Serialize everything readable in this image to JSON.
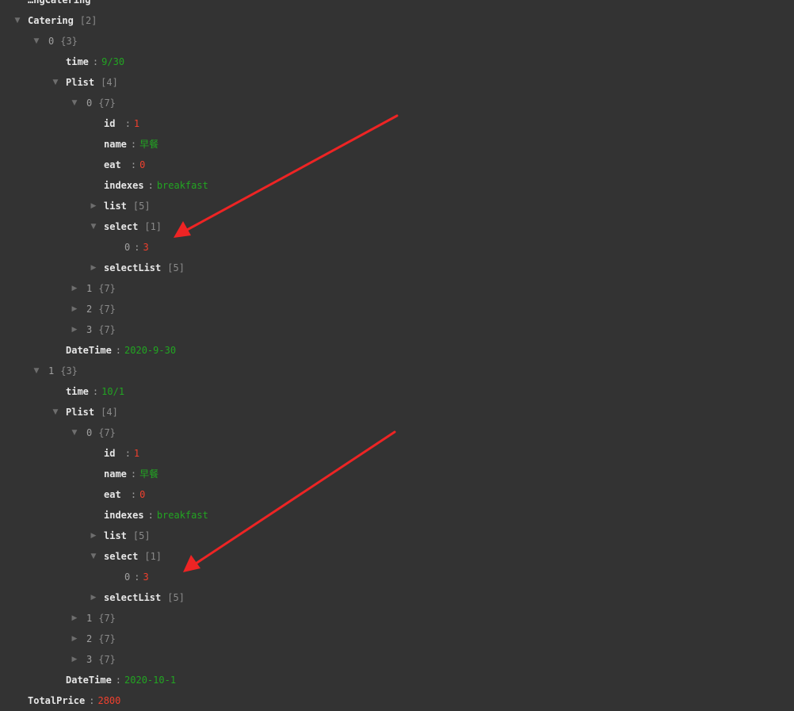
{
  "colors": {
    "background": "#333333",
    "key": "#e6e6e6",
    "number": "#f0402e",
    "string": "#22a522",
    "count": "#8a8a8a",
    "arrow": "#ee2424"
  },
  "icons": {
    "expanded": "caret-down-icon",
    "collapsed": "caret-right-icon"
  },
  "rows": [
    {
      "text_key": "…ngCatering",
      "kind": "key",
      "depth": 0,
      "toggle": "none",
      "partial": true
    },
    {
      "key": "Catering",
      "count": "[2]",
      "kind": "key",
      "depth": 0,
      "toggle": "open"
    },
    {
      "key": "0",
      "count": "{3}",
      "kind": "idx",
      "depth": 1,
      "toggle": "open"
    },
    {
      "key": "time",
      "value": "9/30",
      "vtype": "str",
      "kind": "key",
      "depth": 2,
      "toggle": "none"
    },
    {
      "key": "Plist",
      "count": "[4]",
      "kind": "key",
      "depth": 2,
      "toggle": "open"
    },
    {
      "key": "0",
      "count": "{7}",
      "kind": "idx",
      "depth": 3,
      "toggle": "open"
    },
    {
      "key": "id  ",
      "value": "1",
      "vtype": "num",
      "kind": "key",
      "depth": 4,
      "toggle": "none"
    },
    {
      "key": "name",
      "value": "早餐",
      "vtype": "str",
      "kind": "key",
      "depth": 4,
      "toggle": "none"
    },
    {
      "key": "eat ",
      "value": "0",
      "vtype": "num",
      "kind": "key",
      "depth": 4,
      "toggle": "none"
    },
    {
      "key": "indexes",
      "value": "breakfast",
      "vtype": "str",
      "kind": "key",
      "depth": 4,
      "toggle": "none"
    },
    {
      "key": "list",
      "count": "[5]",
      "kind": "key",
      "depth": 4,
      "toggle": "closed"
    },
    {
      "key": "select",
      "count": "[1]",
      "kind": "key",
      "depth": 4,
      "toggle": "open"
    },
    {
      "key": "0",
      "value": "3",
      "vtype": "num",
      "kind": "idx",
      "depth": 5,
      "toggle": "none"
    },
    {
      "key": "selectList",
      "count": "[5]",
      "kind": "key",
      "depth": 4,
      "toggle": "closed"
    },
    {
      "key": "1",
      "count": "{7}",
      "kind": "idx",
      "depth": 3,
      "toggle": "closed"
    },
    {
      "key": "2",
      "count": "{7}",
      "kind": "idx",
      "depth": 3,
      "toggle": "closed"
    },
    {
      "key": "3",
      "count": "{7}",
      "kind": "idx",
      "depth": 3,
      "toggle": "closed"
    },
    {
      "key": "DateTime",
      "value": "2020-9-30",
      "vtype": "str",
      "kind": "key",
      "depth": 2,
      "toggle": "none"
    },
    {
      "key": "1",
      "count": "{3}",
      "kind": "idx",
      "depth": 1,
      "toggle": "open"
    },
    {
      "key": "time",
      "value": "10/1",
      "vtype": "str",
      "kind": "key",
      "depth": 2,
      "toggle": "none"
    },
    {
      "key": "Plist",
      "count": "[4]",
      "kind": "key",
      "depth": 2,
      "toggle": "open"
    },
    {
      "key": "0",
      "count": "{7}",
      "kind": "idx",
      "depth": 3,
      "toggle": "open"
    },
    {
      "key": "id  ",
      "value": "1",
      "vtype": "num",
      "kind": "key",
      "depth": 4,
      "toggle": "none"
    },
    {
      "key": "name",
      "value": "早餐",
      "vtype": "str",
      "kind": "key",
      "depth": 4,
      "toggle": "none"
    },
    {
      "key": "eat ",
      "value": "0",
      "vtype": "num",
      "kind": "key",
      "depth": 4,
      "toggle": "none"
    },
    {
      "key": "indexes",
      "value": "breakfast",
      "vtype": "str",
      "kind": "key",
      "depth": 4,
      "toggle": "none"
    },
    {
      "key": "list",
      "count": "[5]",
      "kind": "key",
      "depth": 4,
      "toggle": "closed"
    },
    {
      "key": "select",
      "count": "[1]",
      "kind": "key",
      "depth": 4,
      "toggle": "open"
    },
    {
      "key": "0",
      "value": "3",
      "vtype": "num",
      "kind": "idx",
      "depth": 5,
      "toggle": "none"
    },
    {
      "key": "selectList",
      "count": "[5]",
      "kind": "key",
      "depth": 4,
      "toggle": "closed"
    },
    {
      "key": "1",
      "count": "{7}",
      "kind": "idx",
      "depth": 3,
      "toggle": "closed"
    },
    {
      "key": "2",
      "count": "{7}",
      "kind": "idx",
      "depth": 3,
      "toggle": "closed"
    },
    {
      "key": "3",
      "count": "{7}",
      "kind": "idx",
      "depth": 3,
      "toggle": "closed"
    },
    {
      "key": "DateTime",
      "value": "2020-10-1",
      "vtype": "str",
      "kind": "key",
      "depth": 2,
      "toggle": "none"
    },
    {
      "key": "TotalPrice",
      "value": "2800",
      "vtype": "num",
      "kind": "key",
      "depth": 0,
      "toggle": "none"
    }
  ]
}
